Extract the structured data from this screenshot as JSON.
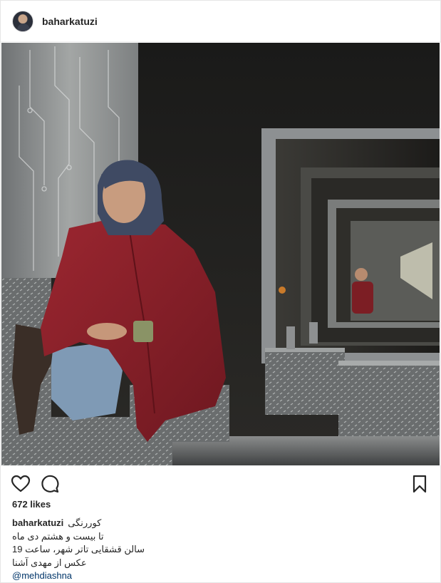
{
  "header": {
    "username": "baharkatuzi",
    "avatar_icon": "profile-avatar"
  },
  "photo": {
    "alt_icon": "post-photo"
  },
  "actions": {
    "like_icon": "heart-icon",
    "comment_icon": "comment-icon",
    "save_icon": "bookmark-icon"
  },
  "likes": {
    "label": "672 likes"
  },
  "caption": {
    "username": "baharkatuzi",
    "lines": [
      "کوررنگی",
      "تا بیست و هشتم دی ماه",
      "سالن قشقایی تاتر شهر، ساعت 19",
      "عکس از مهدی آشنا"
    ],
    "mention": "@mehdiashna"
  },
  "colors": {
    "text": "#262626",
    "mention": "#003569",
    "border": "#e6e6e6",
    "coat": "#8e1f27"
  }
}
